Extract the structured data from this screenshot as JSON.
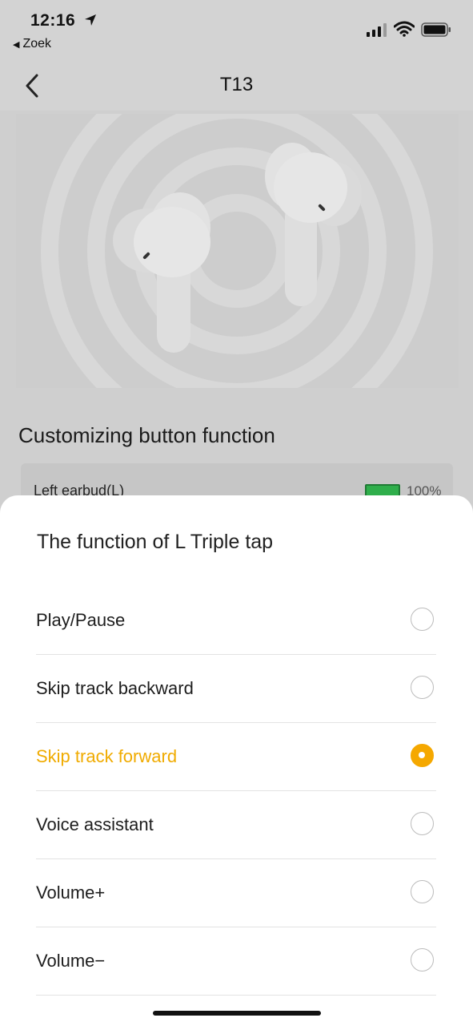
{
  "status_bar": {
    "time": "12:16",
    "back_app_label": "Zoek",
    "icons": [
      "location-arrow-icon",
      "cellular-signal-icon",
      "wifi-icon",
      "battery-icon"
    ]
  },
  "nav": {
    "title": "T13",
    "back_icon": "chevron-left-icon"
  },
  "hero": {
    "image": "earbuds-product-image"
  },
  "customize": {
    "title": "Customizing button function",
    "left_earbud": {
      "label": "Left earbud(L)",
      "battery_percent": "100%",
      "battery_color": "#2fae4b"
    }
  },
  "sheet": {
    "title": "The function of L Triple tap",
    "accent_color": "#f5a800",
    "options": [
      {
        "label": "Play/Pause",
        "selected": false
      },
      {
        "label": "Skip track backward",
        "selected": false
      },
      {
        "label": "Skip track forward",
        "selected": true
      },
      {
        "label": "Voice assistant",
        "selected": false
      },
      {
        "label": "Volume+",
        "selected": false
      },
      {
        "label": "Volume−",
        "selected": false
      }
    ]
  }
}
